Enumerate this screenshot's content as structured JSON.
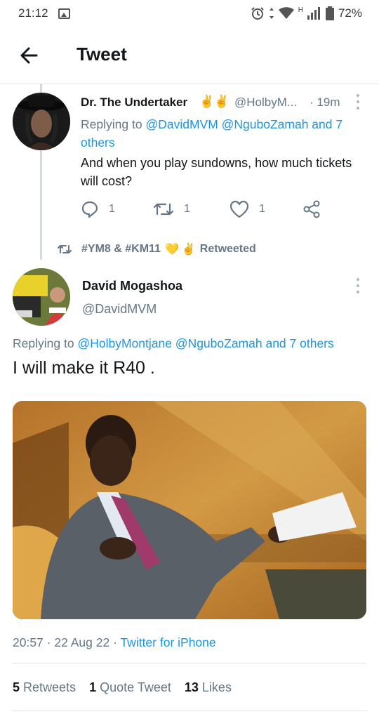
{
  "status_bar": {
    "time": "21:12",
    "network": "H",
    "battery": "72%"
  },
  "app_bar": {
    "title": "Tweet"
  },
  "parent_tweet": {
    "name": "Dr. The Undertaker",
    "name_emoji": "✌️✌️",
    "handle": "@HolbyM...",
    "dot": "·",
    "time": "19m",
    "reply_prefix": "Replying to",
    "reply_to": "@DavidMVM @NguboZamah and 7 others",
    "text": "And when you play sundowns, how much tickets will cost?",
    "replies": "1",
    "retweets": "1",
    "likes": "1"
  },
  "retweet_banner": {
    "prefix": "#YM8 & #KM11",
    "heart": "💛",
    "hand": "✌️",
    "suffix": "Retweeted"
  },
  "main_tweet": {
    "name": "David Mogashoa",
    "handle": "@DavidMVM",
    "reply_prefix": "Replying to",
    "reply_to": "@HolbyMontjane @NguboZamah and 7 others",
    "text": "I will make it R40 .",
    "time": "20:57",
    "sep1": "·",
    "date": "22 Aug 22",
    "sep2": "·",
    "source": "Twitter for iPhone",
    "retweet_count": "5",
    "retweet_label": "Retweets",
    "quote_count": "1",
    "quote_label": "Quote Tweet",
    "like_count": "13",
    "like_label": "Likes"
  },
  "colors": {
    "accent": "#1b95e0",
    "muted": "#657786",
    "text": "#14171a",
    "divider": "#dfe3e6"
  },
  "icons": [
    "back-arrow-icon",
    "reply-icon",
    "retweet-icon",
    "like-icon",
    "share-icon",
    "more-icon",
    "gallery-icon",
    "alarm-icon",
    "wifi-icon",
    "signal-icon",
    "battery-icon"
  ]
}
